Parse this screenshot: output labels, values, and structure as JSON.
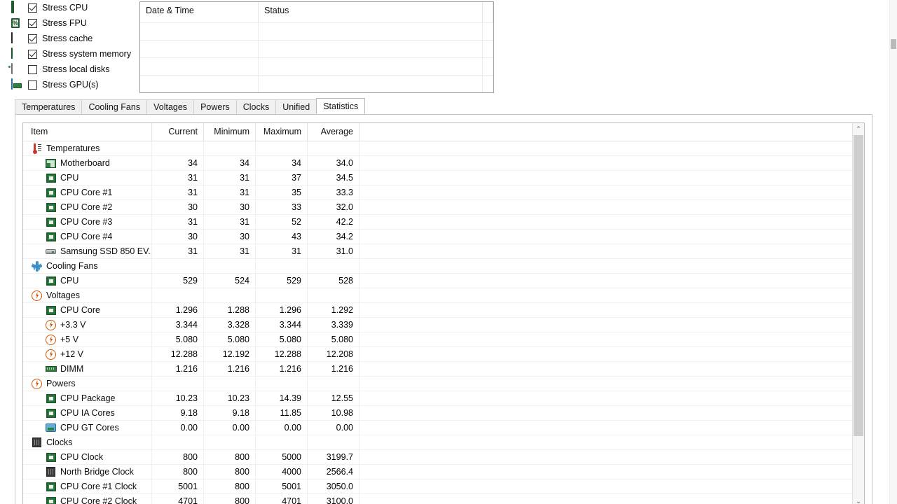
{
  "stress_options": {
    "items": [
      {
        "label": "Stress CPU",
        "checked": true,
        "icon": "cpu-chip-icon"
      },
      {
        "label": "Stress FPU",
        "checked": true,
        "icon": "fpu-chip-icon"
      },
      {
        "label": "Stress cache",
        "checked": true,
        "icon": "cache-module-icon"
      },
      {
        "label": "Stress system memory",
        "checked": true,
        "icon": "memory-dimm-icon"
      },
      {
        "label": "Stress local disks",
        "checked": false,
        "icon": "hard-disk-icon"
      },
      {
        "label": "Stress GPU(s)",
        "checked": false,
        "icon": "gpu-monitor-icon"
      }
    ]
  },
  "log_panel": {
    "columns": [
      "Date & Time",
      "Status"
    ],
    "rows": []
  },
  "tabs": [
    {
      "label": "Temperatures",
      "active": false
    },
    {
      "label": "Cooling Fans",
      "active": false
    },
    {
      "label": "Voltages",
      "active": false
    },
    {
      "label": "Powers",
      "active": false
    },
    {
      "label": "Clocks",
      "active": false
    },
    {
      "label": "Unified",
      "active": false
    },
    {
      "label": "Statistics",
      "active": true
    }
  ],
  "statistics": {
    "columns": [
      "Item",
      "Current",
      "Minimum",
      "Maximum",
      "Average"
    ],
    "rows": [
      {
        "type": "group",
        "icon": "thermometer-icon",
        "label": "Temperatures",
        "current": "",
        "minimum": "",
        "maximum": "",
        "average": ""
      },
      {
        "type": "item",
        "icon": "motherboard-icon",
        "label": "Motherboard",
        "current": "34",
        "minimum": "34",
        "maximum": "34",
        "average": "34.0"
      },
      {
        "type": "item",
        "icon": "cpu-chip-icon",
        "label": "CPU",
        "current": "31",
        "minimum": "31",
        "maximum": "37",
        "average": "34.5"
      },
      {
        "type": "item",
        "icon": "cpu-chip-icon",
        "label": "CPU Core #1",
        "current": "31",
        "minimum": "31",
        "maximum": "35",
        "average": "33.3"
      },
      {
        "type": "item",
        "icon": "cpu-chip-icon",
        "label": "CPU Core #2",
        "current": "30",
        "minimum": "30",
        "maximum": "33",
        "average": "32.0"
      },
      {
        "type": "item",
        "icon": "cpu-chip-icon",
        "label": "CPU Core #3",
        "current": "31",
        "minimum": "31",
        "maximum": "52",
        "average": "42.2"
      },
      {
        "type": "item",
        "icon": "cpu-chip-icon",
        "label": "CPU Core #4",
        "current": "30",
        "minimum": "30",
        "maximum": "43",
        "average": "34.2"
      },
      {
        "type": "item",
        "icon": "ssd-icon",
        "label": "Samsung SSD 850 EV...",
        "current": "31",
        "minimum": "31",
        "maximum": "31",
        "average": "31.0"
      },
      {
        "type": "group",
        "icon": "fan-icon",
        "label": "Cooling Fans",
        "current": "",
        "minimum": "",
        "maximum": "",
        "average": ""
      },
      {
        "type": "item",
        "icon": "cpu-chip-icon",
        "label": "CPU",
        "current": "529",
        "minimum": "524",
        "maximum": "529",
        "average": "528"
      },
      {
        "type": "group",
        "icon": "voltage-bolt-icon",
        "label": "Voltages",
        "current": "",
        "minimum": "",
        "maximum": "",
        "average": ""
      },
      {
        "type": "item",
        "icon": "cpu-chip-icon",
        "label": "CPU Core",
        "current": "1.296",
        "minimum": "1.288",
        "maximum": "1.296",
        "average": "1.292"
      },
      {
        "type": "item",
        "icon": "voltage-bolt-icon",
        "label": "+3.3 V",
        "current": "3.344",
        "minimum": "3.328",
        "maximum": "3.344",
        "average": "3.339"
      },
      {
        "type": "item",
        "icon": "voltage-bolt-icon",
        "label": "+5 V",
        "current": "5.080",
        "minimum": "5.080",
        "maximum": "5.080",
        "average": "5.080"
      },
      {
        "type": "item",
        "icon": "voltage-bolt-icon",
        "label": "+12 V",
        "current": "12.288",
        "minimum": "12.192",
        "maximum": "12.288",
        "average": "12.208"
      },
      {
        "type": "item",
        "icon": "memory-dimm-icon",
        "label": "DIMM",
        "current": "1.216",
        "minimum": "1.216",
        "maximum": "1.216",
        "average": "1.216"
      },
      {
        "type": "group",
        "icon": "voltage-bolt-icon",
        "label": "Powers",
        "current": "",
        "minimum": "",
        "maximum": "",
        "average": ""
      },
      {
        "type": "item",
        "icon": "cpu-chip-icon",
        "label": "CPU Package",
        "current": "10.23",
        "minimum": "10.23",
        "maximum": "14.39",
        "average": "12.55"
      },
      {
        "type": "item",
        "icon": "cpu-chip-icon",
        "label": "CPU IA Cores",
        "current": "9.18",
        "minimum": "9.18",
        "maximum": "11.85",
        "average": "10.98"
      },
      {
        "type": "item",
        "icon": "gpu-monitor-icon",
        "label": "CPU GT Cores",
        "current": "0.00",
        "minimum": "0.00",
        "maximum": "0.00",
        "average": "0.00"
      },
      {
        "type": "group",
        "icon": "clock-module-icon",
        "label": "Clocks",
        "current": "",
        "minimum": "",
        "maximum": "",
        "average": ""
      },
      {
        "type": "item",
        "icon": "cpu-chip-icon",
        "label": "CPU Clock",
        "current": "800",
        "minimum": "800",
        "maximum": "5000",
        "average": "3199.7"
      },
      {
        "type": "item",
        "icon": "clock-module-icon",
        "label": "North Bridge Clock",
        "current": "800",
        "minimum": "800",
        "maximum": "4000",
        "average": "2566.4"
      },
      {
        "type": "item",
        "icon": "cpu-chip-icon",
        "label": "CPU Core #1 Clock",
        "current": "5001",
        "minimum": "800",
        "maximum": "5001",
        "average": "3050.0"
      },
      {
        "type": "item",
        "icon": "cpu-chip-icon",
        "label": "CPU Core #2 Clock",
        "current": "4701",
        "minimum": "800",
        "maximum": "4701",
        "average": "3100.0"
      }
    ]
  },
  "scrollbars": {
    "grid_up_arrow": "⌃",
    "grid_down_arrow": "⌄"
  },
  "colors": {
    "accent_green": "#2e7d41",
    "accent_orange": "#d35400",
    "accent_blue": "#3b8fc4",
    "thermometer_red": "#c0392b"
  }
}
